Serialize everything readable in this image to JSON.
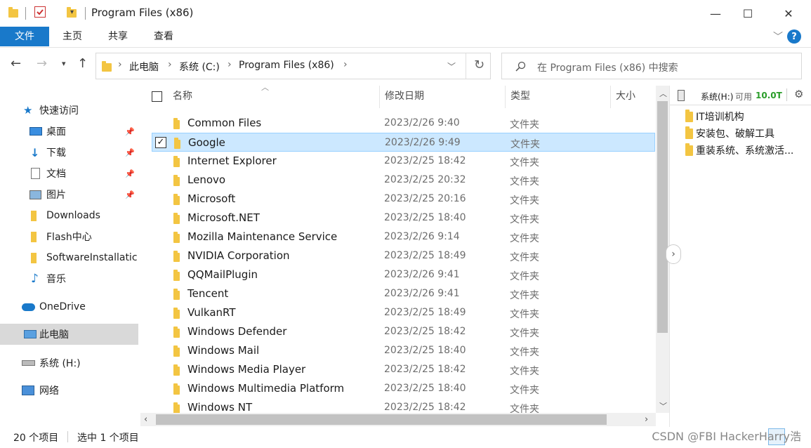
{
  "window": {
    "title": "Program Files (x86)",
    "controls": {
      "minimize": "—",
      "maximize": "☐",
      "close": "✕"
    }
  },
  "ribbon": {
    "tabs": [
      "文件",
      "主页",
      "共享",
      "查看"
    ],
    "help": "?"
  },
  "address": {
    "crumbs": [
      "此电脑",
      "系统 (C:)",
      "Program Files (x86)"
    ],
    "search_placeholder": "在 Program Files (x86) 中搜索"
  },
  "nav": {
    "items": [
      {
        "label": "快速访问",
        "icon": "star-icon",
        "pinned": false
      },
      {
        "label": "桌面",
        "icon": "desktop-icon",
        "pinned": true
      },
      {
        "label": "下载",
        "icon": "download-icon",
        "pinned": true
      },
      {
        "label": "文档",
        "icon": "document-icon",
        "pinned": true
      },
      {
        "label": "图片",
        "icon": "picture-icon",
        "pinned": true
      },
      {
        "label": "Downloads",
        "icon": "folder-icon",
        "pinned": false
      },
      {
        "label": "Flash中心",
        "icon": "folder-icon",
        "pinned": false
      },
      {
        "label": "SoftwareInstallatic",
        "icon": "folder-icon",
        "pinned": false
      },
      {
        "label": "音乐",
        "icon": "music-icon",
        "pinned": false
      },
      {
        "label": "OneDrive",
        "icon": "cloud-icon",
        "pinned": false
      },
      {
        "label": "此电脑",
        "icon": "computer-icon",
        "pinned": false,
        "selected": true
      },
      {
        "label": "系统 (H:)",
        "icon": "drive-icon",
        "pinned": false
      },
      {
        "label": "网络",
        "icon": "network-icon",
        "pinned": false
      }
    ]
  },
  "list": {
    "columns": {
      "name": "名称",
      "date": "修改日期",
      "type": "类型",
      "size": "大小"
    },
    "rows": [
      {
        "name": "Common Files",
        "date": "2023/2/26 9:40",
        "type": "文件夹"
      },
      {
        "name": "Google",
        "date": "2023/2/26 9:49",
        "type": "文件夹",
        "selected": true
      },
      {
        "name": "Internet Explorer",
        "date": "2023/2/25 18:42",
        "type": "文件夹"
      },
      {
        "name": "Lenovo",
        "date": "2023/2/25 20:32",
        "type": "文件夹"
      },
      {
        "name": "Microsoft",
        "date": "2023/2/25 20:16",
        "type": "文件夹"
      },
      {
        "name": "Microsoft.NET",
        "date": "2023/2/25 18:40",
        "type": "文件夹"
      },
      {
        "name": "Mozilla Maintenance Service",
        "date": "2023/2/26 9:14",
        "type": "文件夹"
      },
      {
        "name": "NVIDIA Corporation",
        "date": "2023/2/25 18:49",
        "type": "文件夹"
      },
      {
        "name": "QQMailPlugin",
        "date": "2023/2/26 9:41",
        "type": "文件夹"
      },
      {
        "name": "Tencent",
        "date": "2023/2/26 9:41",
        "type": "文件夹"
      },
      {
        "name": "VulkanRT",
        "date": "2023/2/25 18:49",
        "type": "文件夹"
      },
      {
        "name": "Windows Defender",
        "date": "2023/2/25 18:42",
        "type": "文件夹"
      },
      {
        "name": "Windows Mail",
        "date": "2023/2/25 18:40",
        "type": "文件夹"
      },
      {
        "name": "Windows Media Player",
        "date": "2023/2/25 18:42",
        "type": "文件夹"
      },
      {
        "name": "Windows Multimedia Platform",
        "date": "2023/2/25 18:40",
        "type": "文件夹"
      },
      {
        "name": "Windows NT",
        "date": "2023/2/25 18:42",
        "type": "文件夹"
      }
    ]
  },
  "right_pane": {
    "drive_label": "系统(H:)",
    "free_label": "可用",
    "free_value": "10.0T",
    "items": [
      "IT培训机构",
      "安装包、破解工具",
      "重装系统、系统激活..."
    ]
  },
  "status": {
    "count": "20 个项目",
    "selected": "选中 1 个项目"
  },
  "watermark": "CSDN @FBI HackerHarry浩",
  "colors": {
    "accent": "#1979ca",
    "selection": "#cce8ff",
    "folder": "#f3c542",
    "free_space": "#2a9d2a"
  }
}
